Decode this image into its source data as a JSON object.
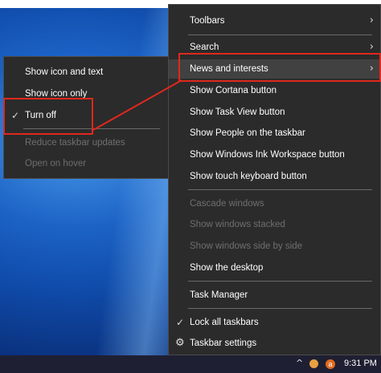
{
  "taskbar_menu": {
    "items": [
      {
        "label": "Toolbars",
        "disabled": false
      },
      {
        "label": "Search",
        "disabled": false
      },
      {
        "label": "News and interests",
        "disabled": false
      },
      {
        "label": "Show Cortana button",
        "disabled": false
      },
      {
        "label": "Show Task View button",
        "disabled": false
      },
      {
        "label": "Show People on the taskbar",
        "disabled": false
      },
      {
        "label": "Show Windows Ink Workspace button",
        "disabled": false
      },
      {
        "label": "Show touch keyboard button",
        "disabled": false
      },
      {
        "label": "Cascade windows",
        "disabled": true
      },
      {
        "label": "Show windows stacked",
        "disabled": true
      },
      {
        "label": "Show windows side by side",
        "disabled": true
      },
      {
        "label": "Show the desktop",
        "disabled": false
      },
      {
        "label": "Task Manager",
        "disabled": false
      },
      {
        "label": "Lock all taskbars",
        "disabled": false,
        "checked": true
      },
      {
        "label": "Taskbar settings",
        "disabled": false,
        "icon": "gear-icon"
      }
    ]
  },
  "submenu": {
    "items": [
      {
        "label": "Show icon and text",
        "disabled": false
      },
      {
        "label": "Show icon only",
        "disabled": false
      },
      {
        "label": "Turn off",
        "disabled": false,
        "checked": true
      },
      {
        "label": "Reduce taskbar updates",
        "disabled": true
      },
      {
        "label": "Open on hover",
        "disabled": true
      }
    ]
  },
  "icons": {
    "check": "✓",
    "chevron": "›",
    "gear": "⚙",
    "tray_chevron": "^"
  },
  "tray": {
    "badge": "a",
    "time": "9:31 PM"
  },
  "colors": {
    "menu_bg": "#2b2b2b",
    "highlight": "#414141",
    "annotation_red": "#e0281e",
    "disabled_text": "#6f6f6f"
  }
}
